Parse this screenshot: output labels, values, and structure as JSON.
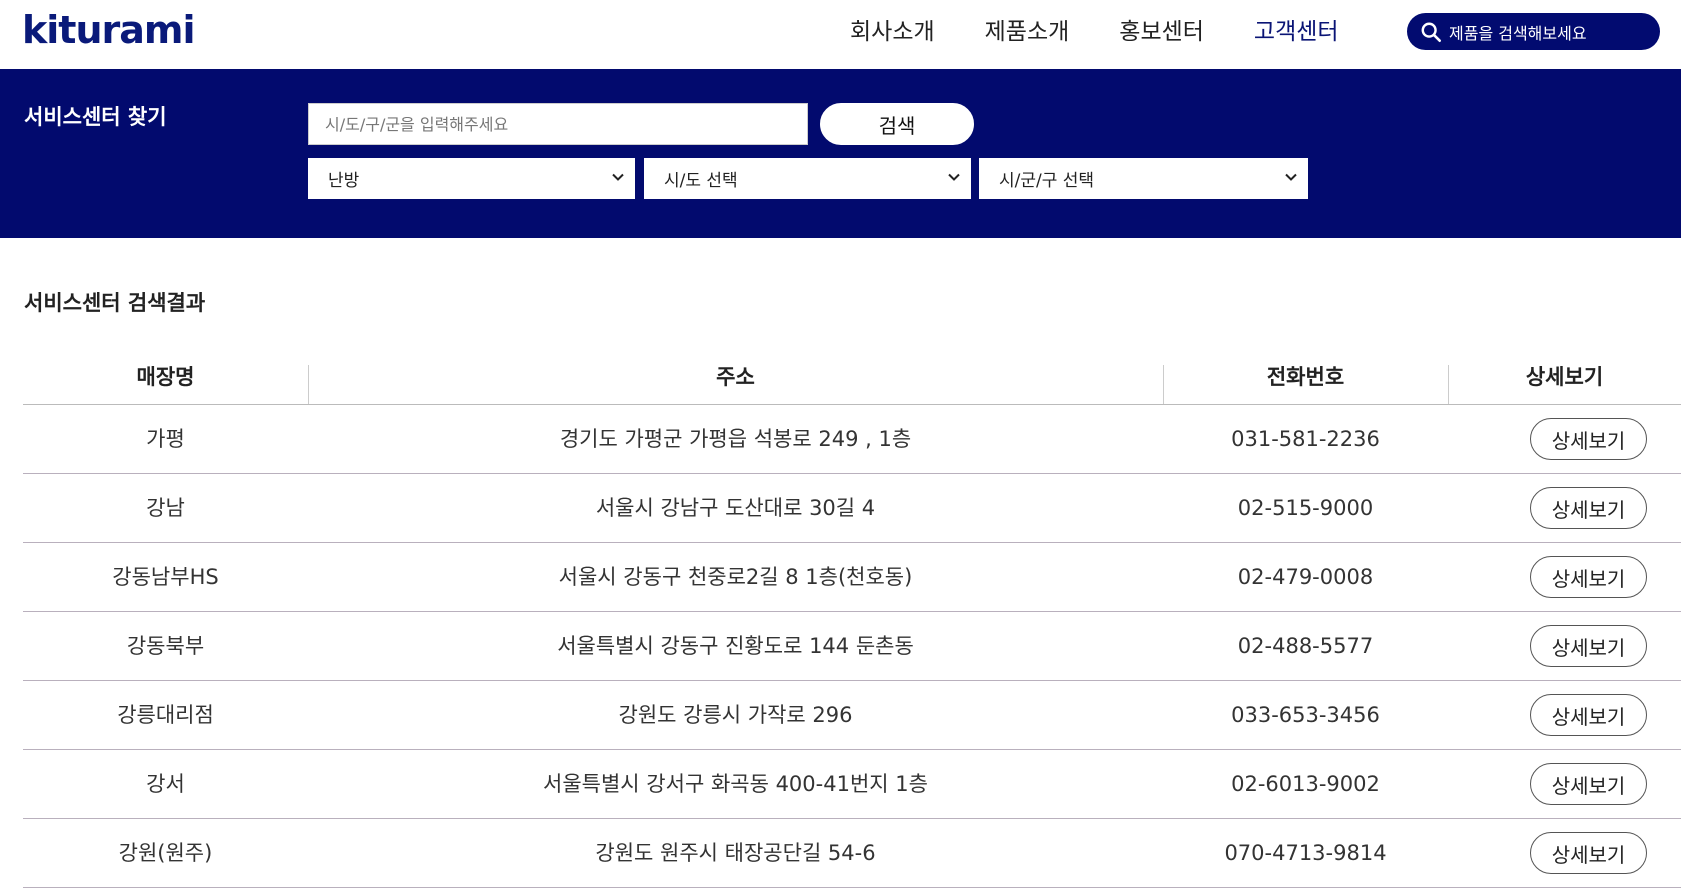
{
  "brand": {
    "logo_text": "kiturami",
    "logo_color": "#0a1a7a",
    "logo_dot_color": "#e8381f"
  },
  "nav": {
    "items": [
      {
        "label": "회사소개"
      },
      {
        "label": "제품소개"
      },
      {
        "label": "홍보센터"
      },
      {
        "label": "고객센터"
      }
    ],
    "search_placeholder": "제품을 검색해보세요"
  },
  "service_search": {
    "title": "서비스센터 찾기",
    "input_placeholder": "시/도/구/군을 입력해주세요",
    "search_button": "검색",
    "selects": [
      {
        "value": "난방"
      },
      {
        "value": "시/도 선택"
      },
      {
        "value": "시/군/구 선택"
      }
    ],
    "band_color": "#020a6e"
  },
  "results": {
    "title": "서비스센터 검색결과",
    "columns": [
      "매장명",
      "주소",
      "전화번호",
      "상세보기"
    ],
    "detail_label": "상세보기",
    "rows": [
      {
        "name": "가평",
        "address": "경기도 가평군 가평읍 석봉로 249 , 1층",
        "phone": "031-581-2236"
      },
      {
        "name": "강남",
        "address": "서울시 강남구 도산대로 30길 4",
        "phone": "02-515-9000"
      },
      {
        "name": "강동남부HS",
        "address": "서울시 강동구 천중로2길 8 1층(천호동)",
        "phone": "02-479-0008"
      },
      {
        "name": "강동북부",
        "address": "서울특별시 강동구 진황도로 144 둔촌동",
        "phone": "02-488-5577"
      },
      {
        "name": "강릉대리점",
        "address": "강원도 강릉시 가작로 296",
        "phone": "033-653-3456"
      },
      {
        "name": "강서",
        "address": "서울특별시 강서구 화곡동 400-41번지 1층",
        "phone": "02-6013-9002"
      },
      {
        "name": "강원(원주)",
        "address": "강원도 원주시 태장공단길 54-6",
        "phone": "070-4713-9814"
      }
    ]
  }
}
